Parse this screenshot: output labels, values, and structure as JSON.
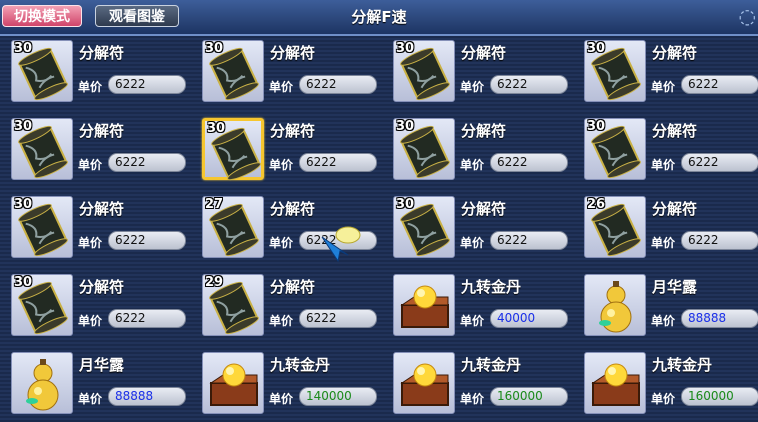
{
  "toolbar": {
    "mode_label": "切换模式",
    "view_label": "观看图鉴",
    "title": "分解F速"
  },
  "price_label": "单价",
  "items": [
    {
      "name": "分解符",
      "qty": "30",
      "price": "6222",
      "type": "scroll",
      "price_color": "black",
      "selected": false
    },
    {
      "name": "分解符",
      "qty": "30",
      "price": "6222",
      "type": "scroll",
      "price_color": "black",
      "selected": false
    },
    {
      "name": "分解符",
      "qty": "30",
      "price": "6222",
      "type": "scroll",
      "price_color": "black",
      "selected": false
    },
    {
      "name": "分解符",
      "qty": "30",
      "price": "6222",
      "type": "scroll",
      "price_color": "black",
      "selected": false
    },
    {
      "name": "分解符",
      "qty": "30",
      "price": "6222",
      "type": "scroll",
      "price_color": "black",
      "selected": false
    },
    {
      "name": "分解符",
      "qty": "30",
      "price": "6222",
      "type": "scroll",
      "price_color": "black",
      "selected": true
    },
    {
      "name": "分解符",
      "qty": "30",
      "price": "6222",
      "type": "scroll",
      "price_color": "black",
      "selected": false
    },
    {
      "name": "分解符",
      "qty": "30",
      "price": "6222",
      "type": "scroll",
      "price_color": "black",
      "selected": false
    },
    {
      "name": "分解符",
      "qty": "30",
      "price": "6222",
      "type": "scroll",
      "price_color": "black",
      "selected": false
    },
    {
      "name": "分解符",
      "qty": "27",
      "price": "6222",
      "type": "scroll",
      "price_color": "black",
      "selected": false
    },
    {
      "name": "分解符",
      "qty": "30",
      "price": "6222",
      "type": "scroll",
      "price_color": "black",
      "selected": false
    },
    {
      "name": "分解符",
      "qty": "26",
      "price": "6222",
      "type": "scroll",
      "price_color": "black",
      "selected": false
    },
    {
      "name": "分解符",
      "qty": "30",
      "price": "6222",
      "type": "scroll",
      "price_color": "black",
      "selected": false
    },
    {
      "name": "分解符",
      "qty": "29",
      "price": "6222",
      "type": "scroll",
      "price_color": "black",
      "selected": false
    },
    {
      "name": "九转金丹",
      "qty": "",
      "price": "40000",
      "type": "elixir",
      "price_color": "blue",
      "selected": false
    },
    {
      "name": "月华露",
      "qty": "",
      "price": "88888",
      "type": "gourd",
      "price_color": "blue",
      "selected": false
    },
    {
      "name": "月华露",
      "qty": "",
      "price": "88888",
      "type": "gourd",
      "price_color": "blue",
      "selected": false
    },
    {
      "name": "九转金丹",
      "qty": "",
      "price": "140000",
      "type": "elixir",
      "price_color": "green",
      "selected": false
    },
    {
      "name": "九转金丹",
      "qty": "",
      "price": "160000",
      "type": "elixir",
      "price_color": "green",
      "selected": false
    },
    {
      "name": "九转金丹",
      "qty": "",
      "price": "160000",
      "type": "elixir",
      "price_color": "green",
      "selected": false
    }
  ],
  "icons": {
    "scroll": "scroll-icon",
    "elixir": "elixir-box-icon",
    "gourd": "gourd-icon"
  }
}
